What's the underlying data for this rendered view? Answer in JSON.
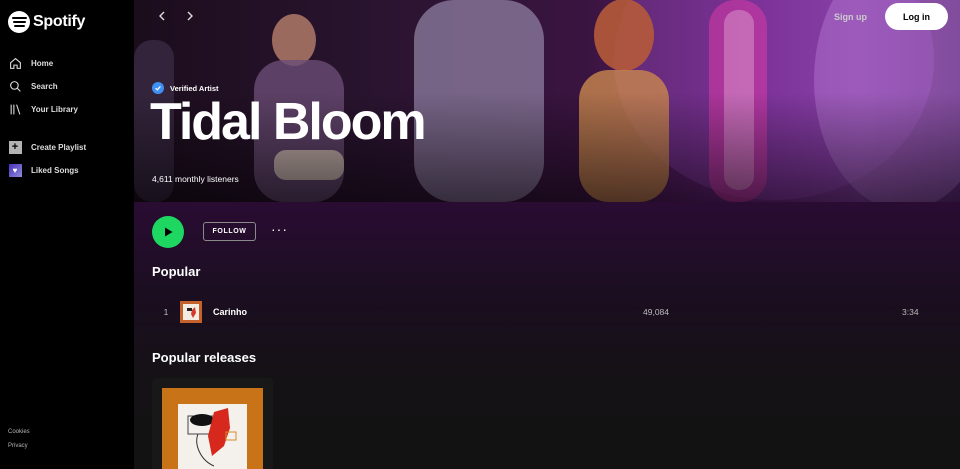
{
  "app": {
    "brand": "Spotify"
  },
  "sidebar": {
    "nav": [
      {
        "label": "Home",
        "icon": "home-icon"
      },
      {
        "label": "Search",
        "icon": "search-icon"
      },
      {
        "label": "Your Library",
        "icon": "library-icon"
      }
    ],
    "actions": [
      {
        "label": "Create Playlist",
        "icon": "plus-icon"
      },
      {
        "label": "Liked Songs",
        "icon": "heart-icon"
      }
    ],
    "legal": [
      "Cookies",
      "Privacy"
    ]
  },
  "header": {
    "signup_label": "Sign up",
    "login_label": "Log in"
  },
  "artist": {
    "verified_label": "Verified Artist",
    "name": "Tidal Bloom",
    "monthly_listeners": "4,611 monthly listeners"
  },
  "actions": {
    "follow_label": "FOLLOW",
    "more_label": "···"
  },
  "popular": {
    "heading": "Popular",
    "tracks": [
      {
        "rank": "1",
        "title": "Carinho",
        "plays": "49,084",
        "duration": "3:34"
      }
    ]
  },
  "releases": {
    "heading": "Popular releases"
  },
  "colors": {
    "accent": "#1ed760",
    "verified": "#3d91f4",
    "sidebar": "#000000",
    "background": "#121212"
  }
}
